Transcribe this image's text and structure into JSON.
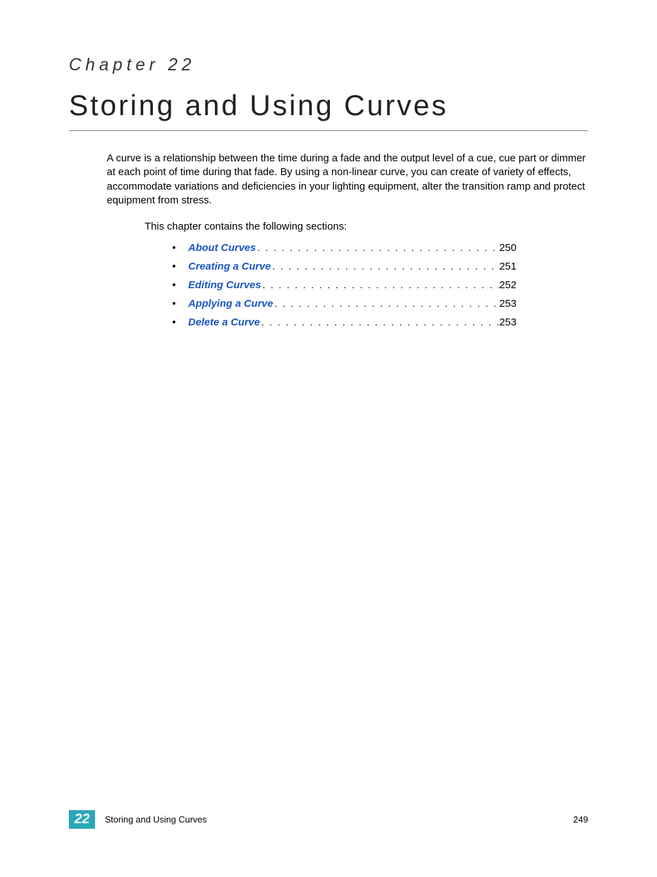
{
  "chapter": {
    "label": "Chapter 22",
    "title": "Storing and Using Curves"
  },
  "intro": "A curve is a relationship between the time during a fade and the output level of a cue, cue part or dimmer at each point of time during that fade. By using a non-linear curve, you can create of variety of effects, accommodate variations and deficiencies in your lighting equipment, alter the transition ramp and protect equipment from stress.",
  "subintro": "This chapter contains the following sections:",
  "toc": [
    {
      "label": "About Curves",
      "page": "250"
    },
    {
      "label": "Creating a Curve",
      "page": "251"
    },
    {
      "label": "Editing Curves",
      "page": "252"
    },
    {
      "label": "Applying a Curve",
      "page": "253"
    },
    {
      "label": "Delete a Curve",
      "page": "253"
    }
  ],
  "footer": {
    "chapter_number": "22",
    "title": "Storing and Using Curves",
    "page": "249"
  },
  "colors": {
    "link": "#1a56c4",
    "badge": "#2aa8b8"
  }
}
